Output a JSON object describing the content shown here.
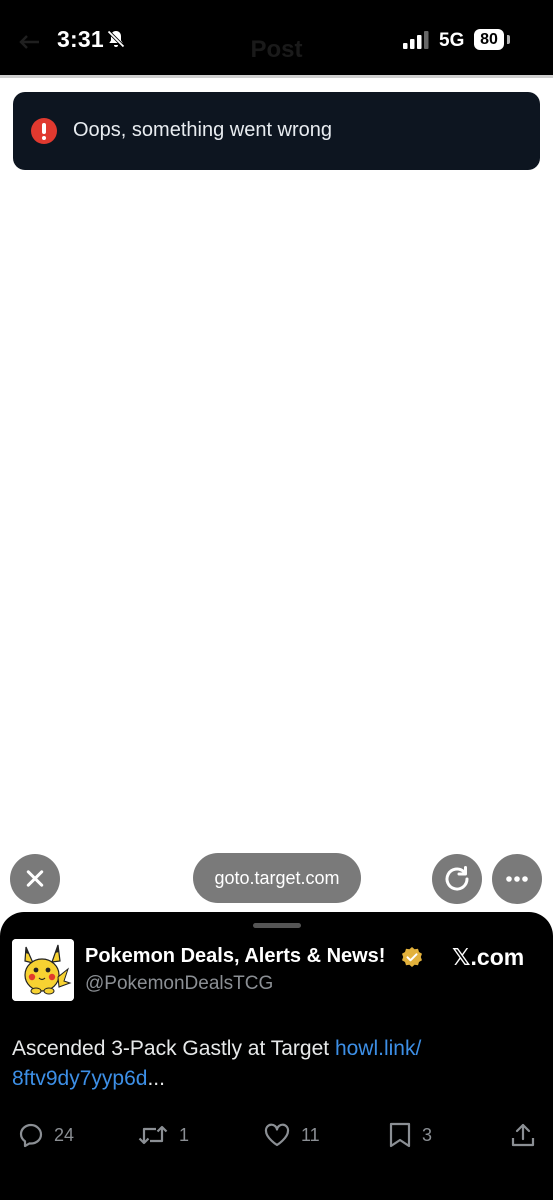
{
  "status_bar": {
    "time": "3:31",
    "network": "5G",
    "battery": "80",
    "ghost_title": "Post"
  },
  "toast": {
    "message": "Oops, something went wrong",
    "icon": "error-icon",
    "color": "#e0392f"
  },
  "browser": {
    "url": "goto.target.com"
  },
  "post": {
    "display_name": "Pokemon Deals, Alerts & News!",
    "handle": "@PokemonDealsTCG",
    "source": "𝕏.com",
    "text": "Ascended 3-Pack Gastly at Target ",
    "link_line1": "howl.link/",
    "link_line2": "8ftv9dy7yyp6d",
    "ellipsis": "...",
    "link_color": "#3d8fe6",
    "metrics": {
      "replies": "24",
      "reposts": "1",
      "likes": "11",
      "bookmarks": "3"
    }
  }
}
